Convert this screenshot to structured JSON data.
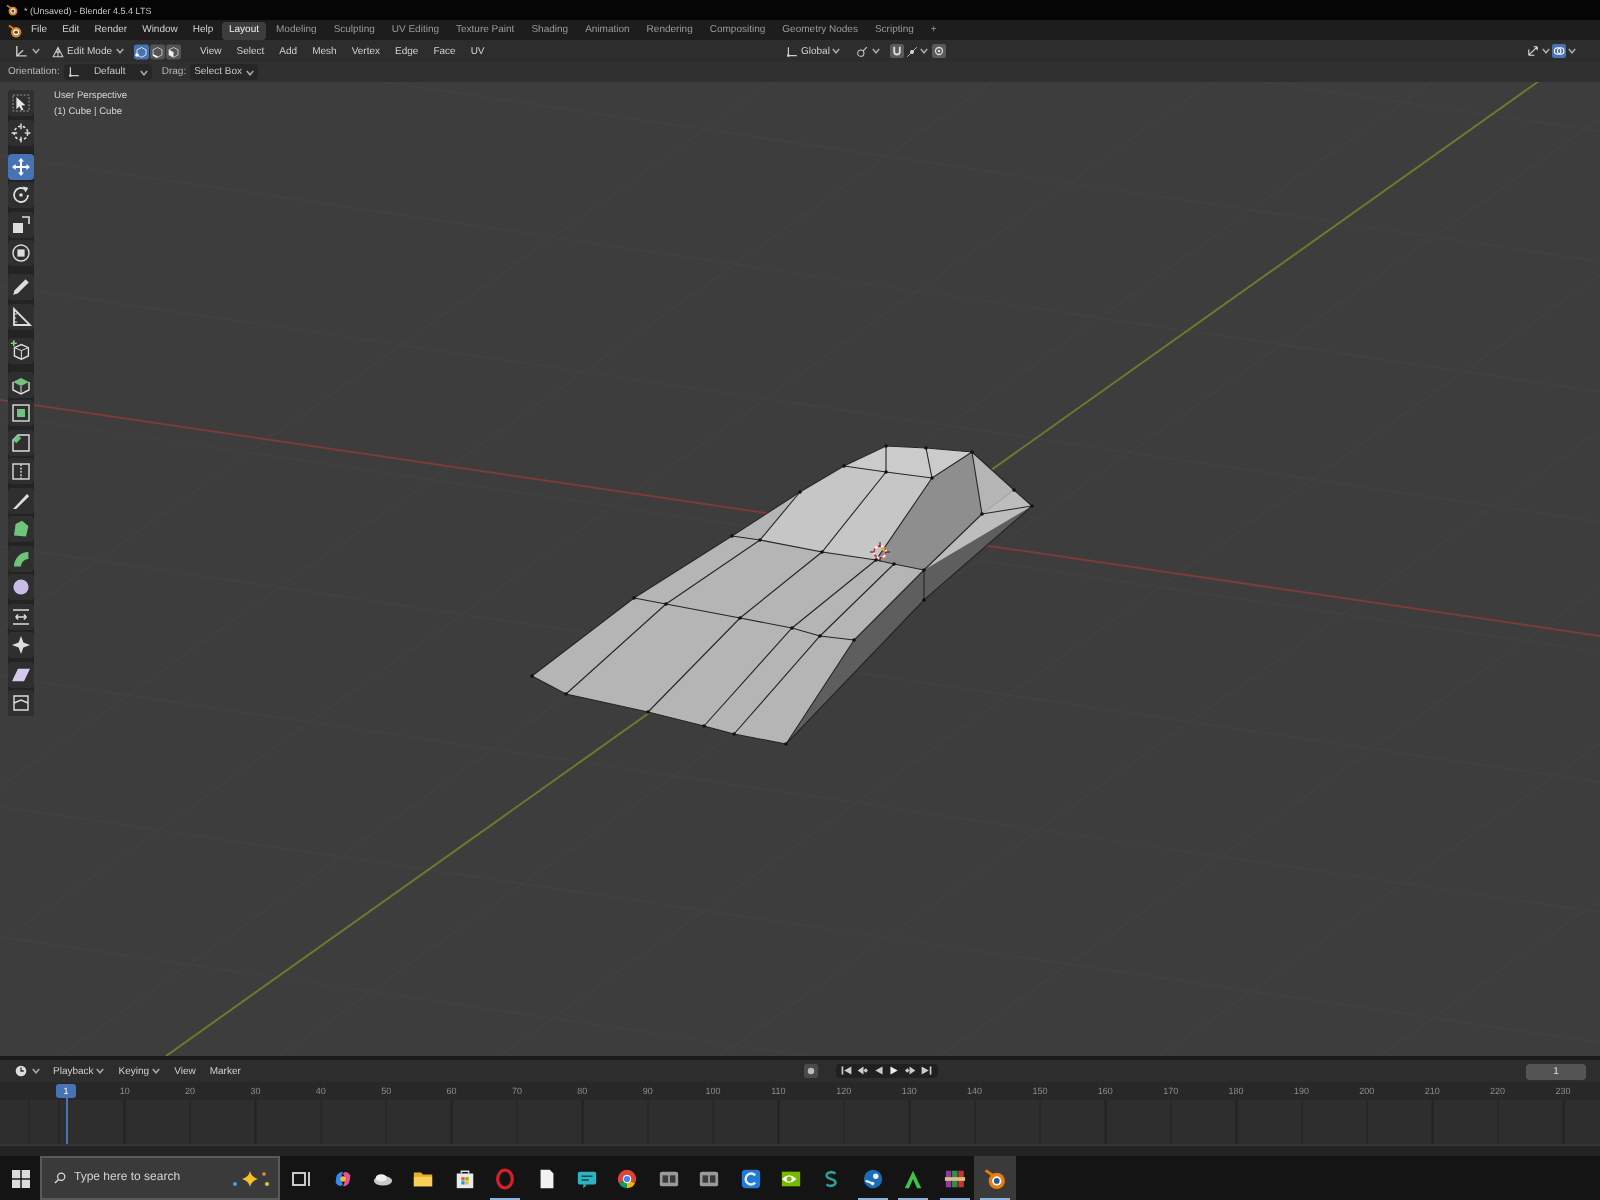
{
  "window": {
    "title": "* (Unsaved) - Blender 4.5.4 LTS"
  },
  "menu_bar": {
    "menus": [
      "File",
      "Edit",
      "Render",
      "Window",
      "Help"
    ],
    "workspace_tabs": [
      {
        "label": "Layout",
        "selected": true
      },
      {
        "label": "Modeling",
        "selected": false
      },
      {
        "label": "Sculpting",
        "selected": false
      },
      {
        "label": "UV Editing",
        "selected": false
      },
      {
        "label": "Texture Paint",
        "selected": false
      },
      {
        "label": "Shading",
        "selected": false
      },
      {
        "label": "Animation",
        "selected": false
      },
      {
        "label": "Rendering",
        "selected": false
      },
      {
        "label": "Compositing",
        "selected": false
      },
      {
        "label": "Geometry Nodes",
        "selected": false
      },
      {
        "label": "Scripting",
        "selected": false
      }
    ],
    "add_tab": "+"
  },
  "viewport_header": {
    "mode": "Edit Mode",
    "select_modes": [
      {
        "kind": "vertex",
        "selected": true
      },
      {
        "kind": "edge",
        "selected": false
      },
      {
        "kind": "face",
        "selected": false
      }
    ],
    "menus": [
      "View",
      "Select",
      "Add",
      "Mesh",
      "Vertex",
      "Edge",
      "Face",
      "UV"
    ],
    "transform_orientation": "Global",
    "snap": {
      "on": false
    },
    "proportional_editing": {
      "on": false
    },
    "view_toggles": [
      {
        "kind": "gizmos",
        "on": false
      },
      {
        "kind": "overlays",
        "on": true
      }
    ]
  },
  "tool_settings": {
    "orientation_label": "Orientation:",
    "orientation": "Default",
    "drag_label": "Drag:",
    "drag": "Select Box"
  },
  "viewport": {
    "view_name": "User Perspective",
    "object_info": "(1) Cube | Cube",
    "toolbar": {
      "groups": [
        [
          {
            "kind": "select_box",
            "selected": false
          },
          {
            "kind": "cursor",
            "selected": false
          }
        ],
        [
          {
            "kind": "move",
            "selected": true
          },
          {
            "kind": "rotate",
            "selected": false
          },
          {
            "kind": "scale",
            "selected": false
          },
          {
            "kind": "transform",
            "selected": false
          }
        ],
        [
          {
            "kind": "annotate",
            "selected": false
          },
          {
            "kind": "measure",
            "selected": false
          }
        ],
        [
          {
            "kind": "add_cube",
            "selected": false
          }
        ],
        [
          {
            "kind": "extrude",
            "selected": false
          },
          {
            "kind": "inset",
            "selected": false
          },
          {
            "kind": "bevel",
            "selected": false
          },
          {
            "kind": "loop_cut",
            "selected": false
          },
          {
            "kind": "knife",
            "selected": false
          },
          {
            "kind": "poly_build",
            "selected": false
          },
          {
            "kind": "spin",
            "selected": false
          },
          {
            "kind": "smooth",
            "selected": false
          },
          {
            "kind": "edge_slide",
            "selected": false
          },
          {
            "kind": "shrink_fatten",
            "selected": false
          },
          {
            "kind": "shear",
            "selected": false
          },
          {
            "kind": "rip",
            "selected": false
          }
        ]
      ]
    }
  },
  "timeline": {
    "menus": [
      {
        "label": "Playback",
        "dropdown": true
      },
      {
        "label": "Keying",
        "dropdown": true
      },
      {
        "label": "View",
        "dropdown": false
      },
      {
        "label": "Marker",
        "dropdown": false
      }
    ],
    "current_frame": "1",
    "playhead_frame": "1",
    "frame_ticks": [
      "10",
      "20",
      "30",
      "40",
      "50",
      "60",
      "70",
      "80",
      "90",
      "100",
      "110",
      "120",
      "130",
      "140",
      "150",
      "160",
      "170",
      "180",
      "190",
      "200",
      "210",
      "220",
      "230"
    ]
  },
  "taskbar": {
    "search": {
      "placeholder": "Type here to search"
    },
    "apps": [
      {
        "kind": "swirl",
        "running": false,
        "active": false
      },
      {
        "kind": "cloud",
        "running": false,
        "active": false
      },
      {
        "kind": "folder",
        "running": false,
        "active": false
      },
      {
        "kind": "store",
        "running": false,
        "active": false
      },
      {
        "kind": "ring",
        "running": true,
        "active": false
      },
      {
        "kind": "document",
        "running": false,
        "active": false
      },
      {
        "kind": "monitor",
        "running": false,
        "active": false
      },
      {
        "kind": "segmented_circle",
        "running": false,
        "active": false
      },
      {
        "kind": "keyboard",
        "running": false,
        "active": false
      },
      {
        "kind": "keyboard",
        "running": false,
        "active": false
      },
      {
        "kind": "arc",
        "running": false,
        "active": false
      },
      {
        "kind": "eye",
        "running": false,
        "active": false
      },
      {
        "kind": "s_curve",
        "running": false,
        "active": false
      },
      {
        "kind": "piston",
        "running": true,
        "active": false
      },
      {
        "kind": "peak",
        "running": true,
        "active": false
      },
      {
        "kind": "books",
        "running": true,
        "active": false
      },
      {
        "kind": "orbit",
        "running": true,
        "active": true
      }
    ]
  }
}
